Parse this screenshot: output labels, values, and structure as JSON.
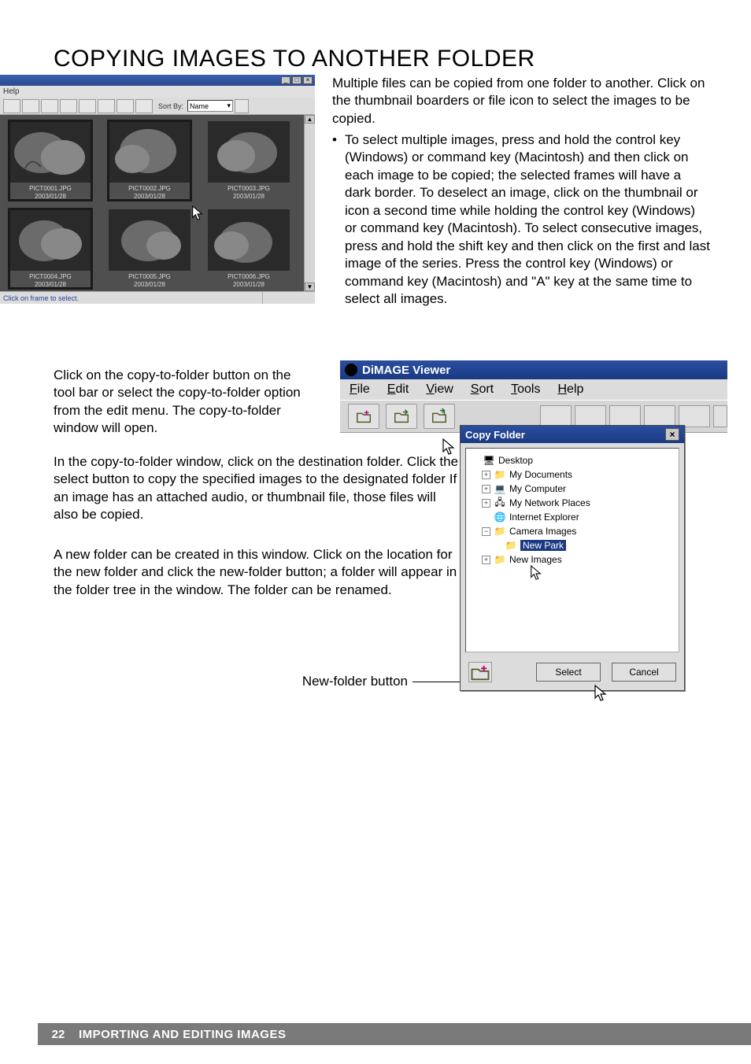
{
  "heading": "COPYING IMAGES TO ANOTHER FOLDER",
  "intro": "Multiple files can be copied from one folder to another. Click on the thumbnail boarders or file icon to select the images to be copied.",
  "bullet": "To select multiple images, press and hold the control key (Windows) or command key (Macintosh) and then click on each image to be copied; the selected frames will have a dark border. To deselect an image, click on the thumbnail or icon a second time while holding the control key (Windows) or command key (Macintosh). To select consecutive images, press and hold the shift key and then click on the first and last image of the series. Press the control key (Windows) or command key (Macintosh) and \"A\" key at the same time to select all images.",
  "p1": "Click on the copy-to-folder button on the tool bar or select the copy-to-folder option from the edit menu. The copy-to-folder window will open.",
  "p2": "In the copy-to-folder window, click on the destination folder. Click the select button to copy the specified images to the designated folder If an image has an attached audio, or thumbnail file, those files will also be copied.",
  "p3": "A new folder can be created in this window. Click on the location for the new folder and click the new-folder button; a folder will appear in the folder tree in the window. The folder can be renamed.",
  "new_folder_button_label": "New-folder button",
  "thumb_window": {
    "menu": "Help",
    "sort_label": "Sort By:",
    "sort_value": "Name",
    "status": "Click on frame to select.",
    "thumbs": [
      {
        "name": "PICT0001.JPG",
        "date": "2003/01/28"
      },
      {
        "name": "PICT0002.JPG",
        "date": "2003/01/28"
      },
      {
        "name": "PICT0003.JPG",
        "date": "2003/01/28"
      },
      {
        "name": "PICT0004.JPG",
        "date": "2003/01/28"
      },
      {
        "name": "PICT0005.JPG",
        "date": "2003/01/28"
      },
      {
        "name": "PICT0006.JPG",
        "date": "2003/01/28"
      }
    ]
  },
  "dimage": {
    "title": "DiMAGE Viewer",
    "menu": [
      "File",
      "Edit",
      "View",
      "Sort",
      "Tools",
      "Help"
    ]
  },
  "copy_folder": {
    "title": "Copy Folder",
    "tree": {
      "desktop": "Desktop",
      "my_documents": "My Documents",
      "my_computer": "My Computer",
      "my_network": "My Network Places",
      "ie": "Internet Explorer",
      "camera_images": "Camera Images",
      "new_park": "New Park",
      "new_images": "New Images"
    },
    "select": "Select",
    "cancel": "Cancel"
  },
  "footer": {
    "page": "22",
    "section": "IMPORTING AND EDITING IMAGES"
  }
}
